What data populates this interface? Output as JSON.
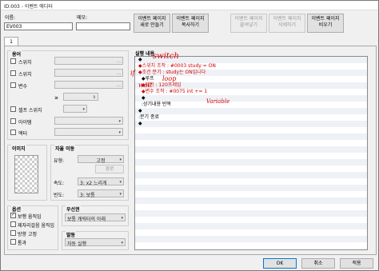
{
  "window": {
    "title": "ID:003 - 이벤트 에디터"
  },
  "header": {
    "name_label": "이름:",
    "name_value": "EV003",
    "note_label": "메모:",
    "note_value": "",
    "buttons": [
      {
        "label1": "이벤트 페이지",
        "label2": "새로 만들기",
        "enabled": true
      },
      {
        "label1": "이벤트 페이지",
        "label2": "복사하기",
        "enabled": true
      },
      {
        "label1": "이벤트 페이지",
        "label2": "붙여넣기",
        "enabled": false
      },
      {
        "label1": "이벤트 페이지",
        "label2": "삭제하기",
        "enabled": false
      },
      {
        "label1": "이벤트 페이지",
        "label2": "비우기",
        "enabled": true
      }
    ]
  },
  "tabs": [
    {
      "label": "1"
    }
  ],
  "conditions": {
    "title": "용어",
    "items": [
      {
        "label": "스위치"
      },
      {
        "label": "스위치"
      },
      {
        "label": "변수"
      },
      {
        "label": "셀프 스위치"
      },
      {
        "label": "아이템"
      },
      {
        "label": "액터"
      }
    ],
    "ge_label": "≥"
  },
  "image": {
    "title": "이미지"
  },
  "autonomous": {
    "title": "자율 이동",
    "type_label": "유형:",
    "type_value": "고정",
    "route_button": "경로",
    "speed_label": "속도:",
    "speed_value": "3: x2 느리게",
    "freq_label": "빈도:",
    "freq_value": "3: 보통"
  },
  "options": {
    "title": "옵션",
    "items": [
      {
        "label": "보행 움직임",
        "checked": true
      },
      {
        "label": "제자리걸음 움직임",
        "checked": false
      },
      {
        "label": "방향 고정",
        "checked": false
      },
      {
        "label": "통과",
        "checked": false
      }
    ]
  },
  "priority": {
    "title": "우선권",
    "value": "보통 캐릭터의 아래"
  },
  "trigger": {
    "title": "발동",
    "value": "자동 실행"
  },
  "contents": {
    "title": "실행 내용",
    "lines": [
      "◆",
      "◆스위치 조작 : #0003 study = ON",
      "◆조건 분기 : study는 ON입니다",
      "  ◆루프",
      "    ◆대기 : 120프레임",
      "    ◆변수 조작 : #0075 int += 1",
      "    ◆",
      "  :상기내용 반복",
      "  ◆",
      ":분기 종료",
      "◆"
    ],
    "annotations": [
      "switch",
      "if",
      "loop",
      "wait",
      "Variable"
    ]
  },
  "footer": {
    "ok": "OK",
    "cancel": "취소",
    "apply": "적용"
  }
}
